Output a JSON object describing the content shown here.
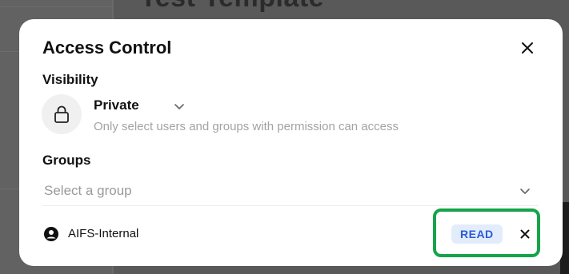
{
  "background": {
    "page_title": "Test Template"
  },
  "modal": {
    "title": "Access Control",
    "close_icon": "close-icon"
  },
  "visibility": {
    "label": "Visibility",
    "icon": "lock-icon",
    "value": "Private",
    "dropdown_icon": "chevron-down-icon",
    "description": "Only select users and groups with permission can access"
  },
  "groups": {
    "label": "Groups",
    "placeholder": "Select a group",
    "dropdown_icon": "chevron-down-icon",
    "members": [
      {
        "icon": "user-circle-icon",
        "name": "AIFS-Internal",
        "permission": "READ",
        "remove_icon": "close-icon"
      }
    ]
  },
  "colors": {
    "highlight": "#16a34a",
    "badge_bg": "#e3ecfb",
    "badge_text": "#2a5bd7"
  }
}
